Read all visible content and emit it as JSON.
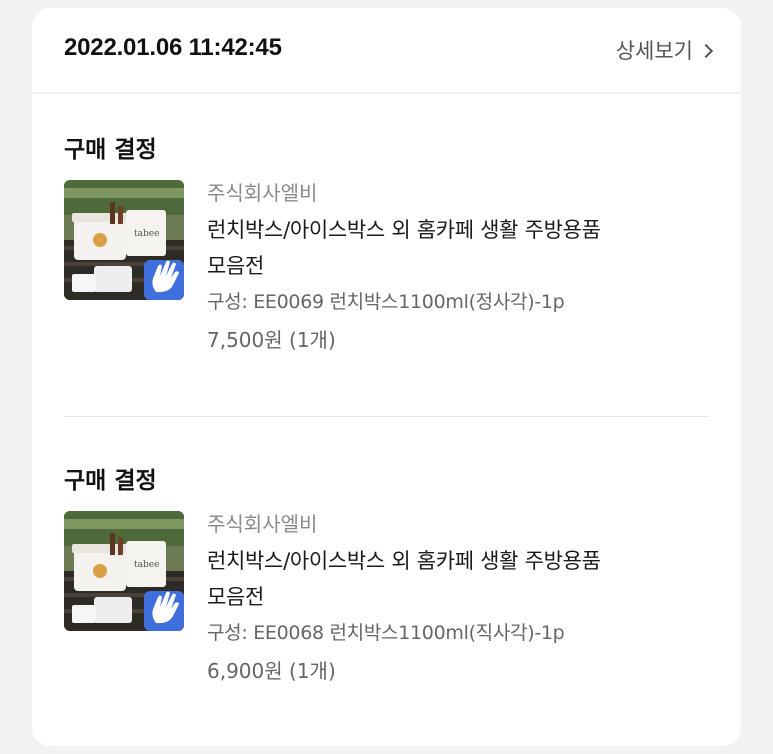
{
  "order": {
    "datetime": "2022.01.06 11:42:45",
    "detail_label": "상세보기"
  },
  "items": [
    {
      "status": "구매 결정",
      "seller": "주식회사엘비",
      "title_line1": "런치박스/아이스박스 외 홈카페 생활 주방용품",
      "title_line2": "모음전",
      "option": "구성: EE0069 런치박스1100ml(정사각)-1p",
      "price": "7,500원 (1개)",
      "thumbnail_icon": "wave-hand-icon"
    },
    {
      "status": "구매 결정",
      "seller": "주식회사엘비",
      "title_line1": "런치박스/아이스박스 외 홈카페 생활 주방용품",
      "title_line2": "모음전",
      "option": "구성: EE0068 런치박스1100ml(직사각)-1p",
      "price": "6,900원 (1개)",
      "thumbnail_icon": "wave-hand-icon"
    }
  ],
  "colors": {
    "background": "#f2f2f4",
    "card": "#ffffff",
    "badge": "#3f6fdc"
  }
}
